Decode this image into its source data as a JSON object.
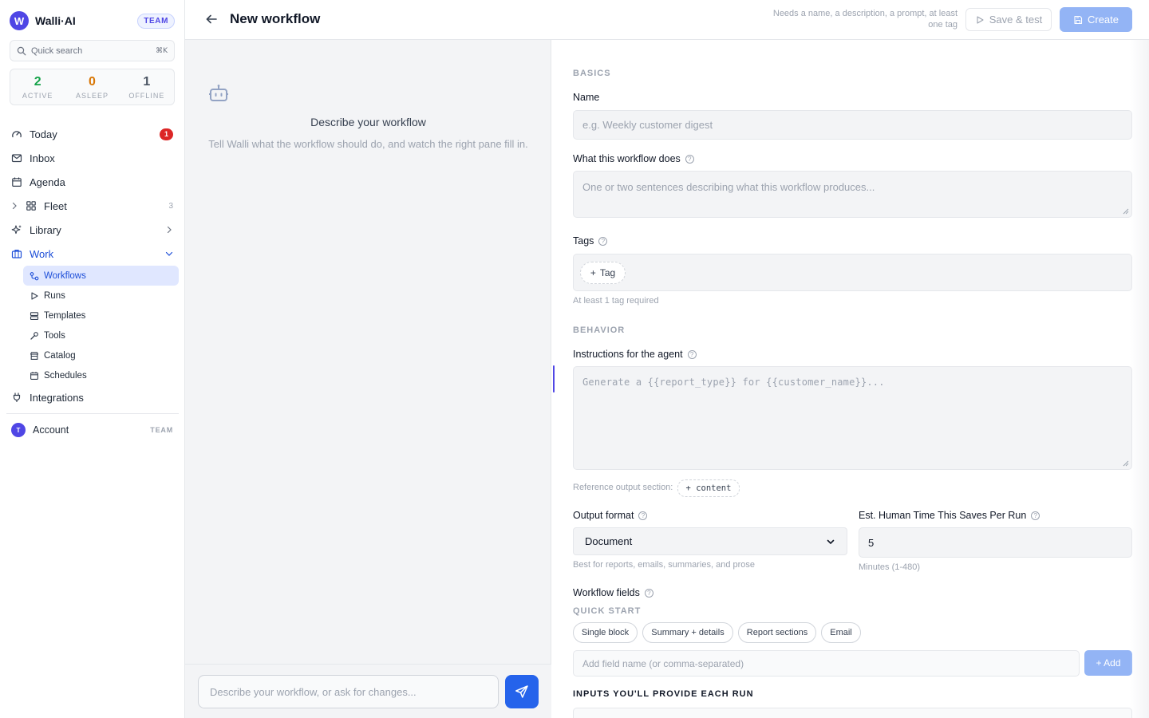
{
  "brand": {
    "logo_letter": "W",
    "name": "Walli·AI",
    "badge": "TEAM"
  },
  "search": {
    "label": "Quick search",
    "shortcut": "⌘K"
  },
  "stats": [
    {
      "value": "2",
      "label": "ACTIVE",
      "color": "#16a34a"
    },
    {
      "value": "0",
      "label": "ASLEEP",
      "color": "#d97706"
    },
    {
      "value": "1",
      "label": "OFFLINE",
      "color": "#4b5563"
    }
  ],
  "nav": {
    "today": {
      "label": "Today",
      "badge": "1"
    },
    "inbox": {
      "label": "Inbox"
    },
    "agenda": {
      "label": "Agenda"
    },
    "fleet": {
      "label": "Fleet",
      "count": "3"
    },
    "library": {
      "label": "Library"
    },
    "work": {
      "label": "Work"
    },
    "work_items": [
      {
        "label": "Workflows",
        "icon": "workflow-icon"
      },
      {
        "label": "Runs",
        "icon": "play-icon"
      },
      {
        "label": "Templates",
        "icon": "templates-icon"
      },
      {
        "label": "Tools",
        "icon": "wrench-icon"
      },
      {
        "label": "Catalog",
        "icon": "store-icon"
      },
      {
        "label": "Schedules",
        "icon": "calendar-icon"
      }
    ],
    "integrations": {
      "label": "Integrations"
    },
    "account": {
      "avatar": "T",
      "label": "Account",
      "tag": "TEAM"
    }
  },
  "header": {
    "title": "New workflow",
    "hint": "Needs a name, a description, a prompt, at least one tag",
    "save_label": "Save & test",
    "create_label": "Create"
  },
  "chat": {
    "title": "Describe your workflow",
    "subtitle": "Tell Walli what the workflow should do, and watch the right pane fill in.",
    "placeholder": "Describe your workflow, or ask for changes..."
  },
  "form": {
    "basics_label": "BASICS",
    "name_label": "Name",
    "name_placeholder": "e.g. Weekly customer digest",
    "desc_label": "What this workflow does",
    "desc_placeholder": "One or two sentences describing what this workflow produces...",
    "tags_label": "Tags",
    "tag_button": "Tag",
    "tags_note": "At least 1 tag required",
    "behavior_label": "BEHAVIOR",
    "instructions_label": "Instructions for the agent",
    "instructions_placeholder": "Generate a {{report_type}} for {{customer_name}}...",
    "reference_label": "Reference output section:",
    "reference_chip": "+ content",
    "output_format_label": "Output format",
    "output_format_value": "Document",
    "output_format_note": "Best for reports, emails, summaries, and prose",
    "time_label": "Est. Human Time This Saves Per Run",
    "time_value": "5",
    "time_note": "Minutes (1-480)",
    "fields_label": "Workflow fields",
    "quick_start_label": "QUICK START",
    "quick_start": [
      "Single block",
      "Summary + details",
      "Report sections",
      "Email"
    ],
    "add_field_placeholder": "Add field name (or comma-separated)",
    "add_button": "+ Add",
    "inputs_label": "INPUTS YOU'LL PROVIDE EACH RUN"
  },
  "colors": {
    "accent": "#2563eb",
    "brand": "#4f46e5",
    "badge_red": "#dc2626",
    "disabled_blue": "#93b4f5"
  }
}
